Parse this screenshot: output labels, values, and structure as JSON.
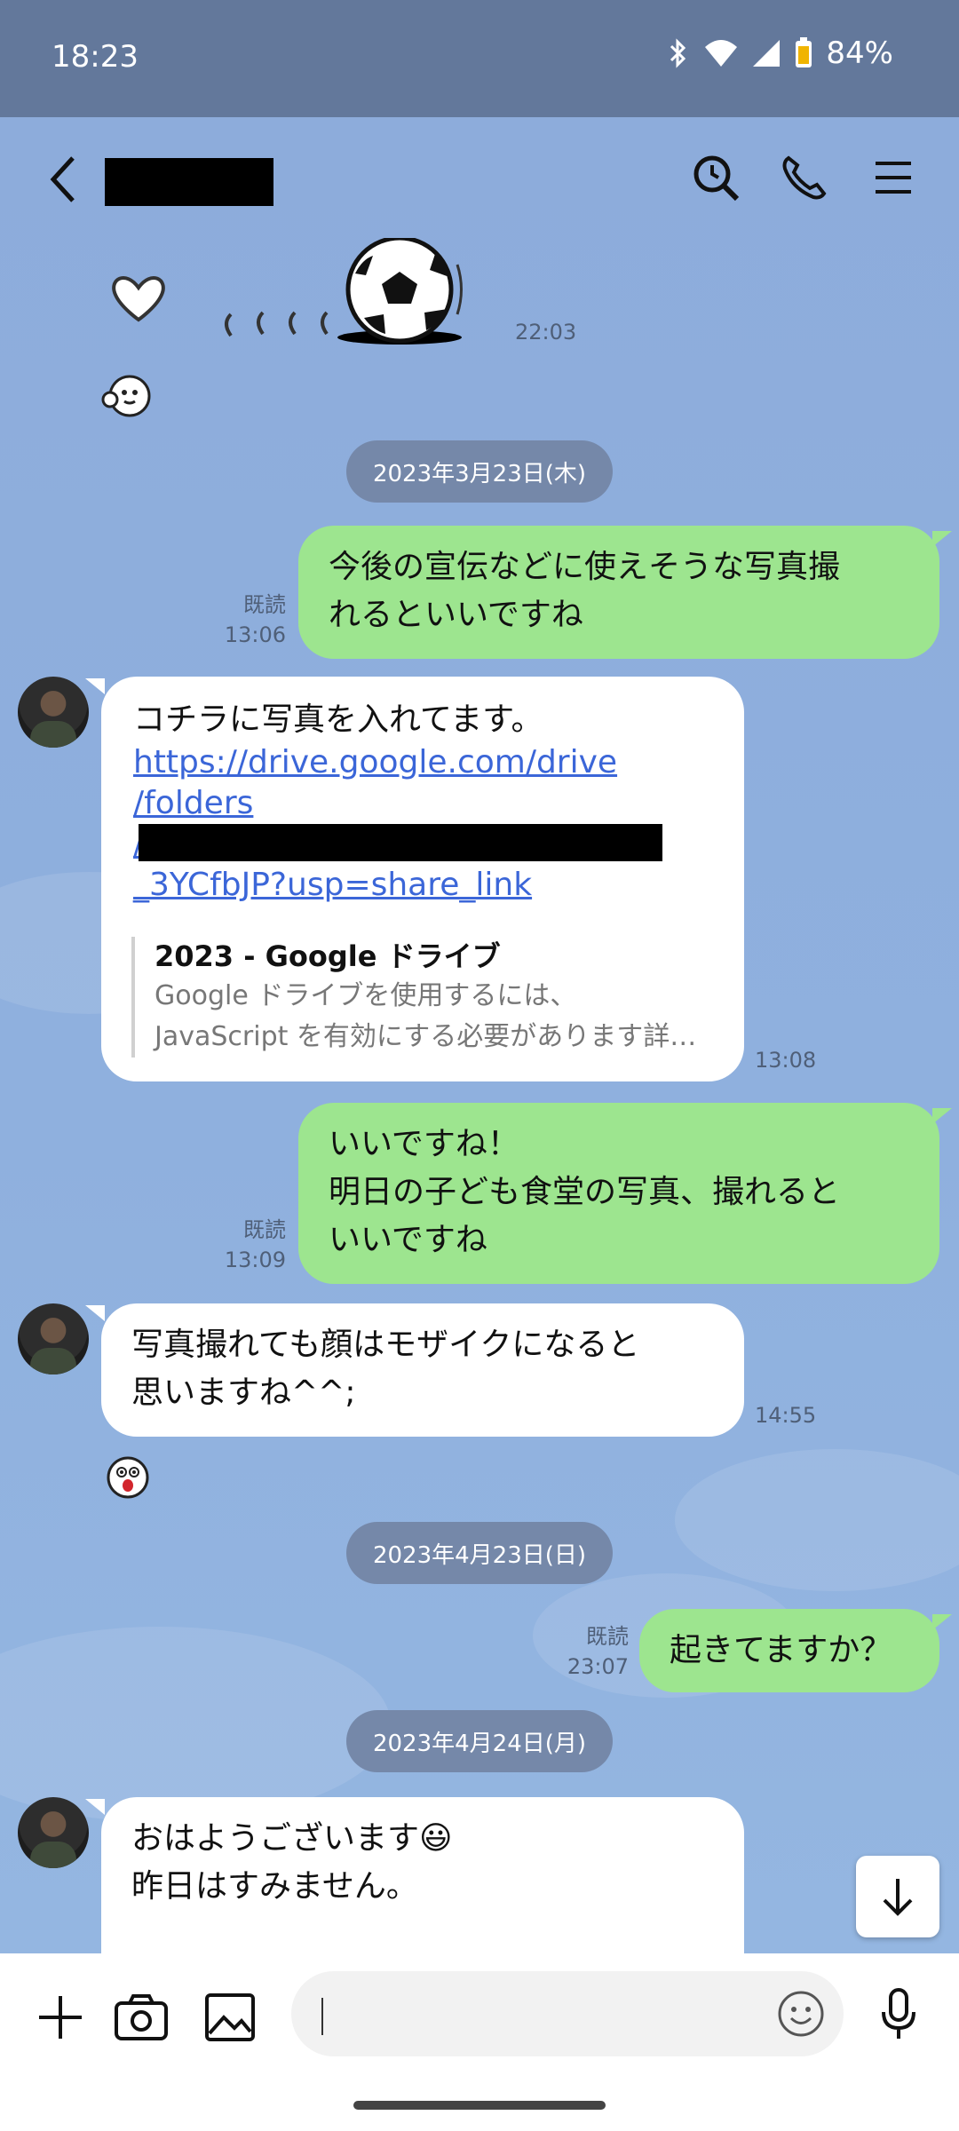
{
  "status_bar": {
    "time": "18:23",
    "battery": "84%"
  },
  "header": {
    "contact_name_redacted": true,
    "icons": [
      "back-icon",
      "search-icon",
      "phone-icon",
      "menu-icon"
    ]
  },
  "messages": {
    "m0": {
      "time": "22:03"
    },
    "date1": "2023年3月23日(木)",
    "m1": {
      "lines": [
        "今後の宣伝などに使えそうな写真撮",
        "れるといいですね"
      ],
      "read": "既読",
      "time": "13:06"
    },
    "m2": {
      "text": "コチラに写真を入れてます。",
      "link_lines": [
        "https://drive.google.com/drive",
        "/folders",
        "/",
        "_3YCfbJP?usp=share_link"
      ],
      "preview_title": "2023 - Google ドライブ",
      "preview_lines": [
        "Google ドライブを使用するには、",
        "JavaScript を有効にする必要があります詳…"
      ],
      "time": "13:08"
    },
    "m3": {
      "lines": [
        "いいですね！",
        "明日の子ども食堂の写真、撮れると",
        "いいですね"
      ],
      "read": "既読",
      "time": "13:09"
    },
    "m4": {
      "lines": [
        "写真撮れても顔はモザイクになると",
        "思いますね^^;"
      ],
      "time": "14:55"
    },
    "date2": "2023年4月23日(日)",
    "m5": {
      "lines": [
        "起きてますか？"
      ],
      "read": "既読",
      "time": "23:07"
    },
    "date3": "2023年4月24日(月)",
    "m6": {
      "lines": [
        "おはようございます😃",
        "昨日はすみません。"
      ]
    }
  },
  "input": {
    "placeholder": ""
  },
  "colors": {
    "header_bg": "#63789b",
    "chat_bg": "#8eaedc",
    "my_bubble": "#9de58f",
    "their_bubble": "#ffffff",
    "link": "#3b66d8"
  }
}
